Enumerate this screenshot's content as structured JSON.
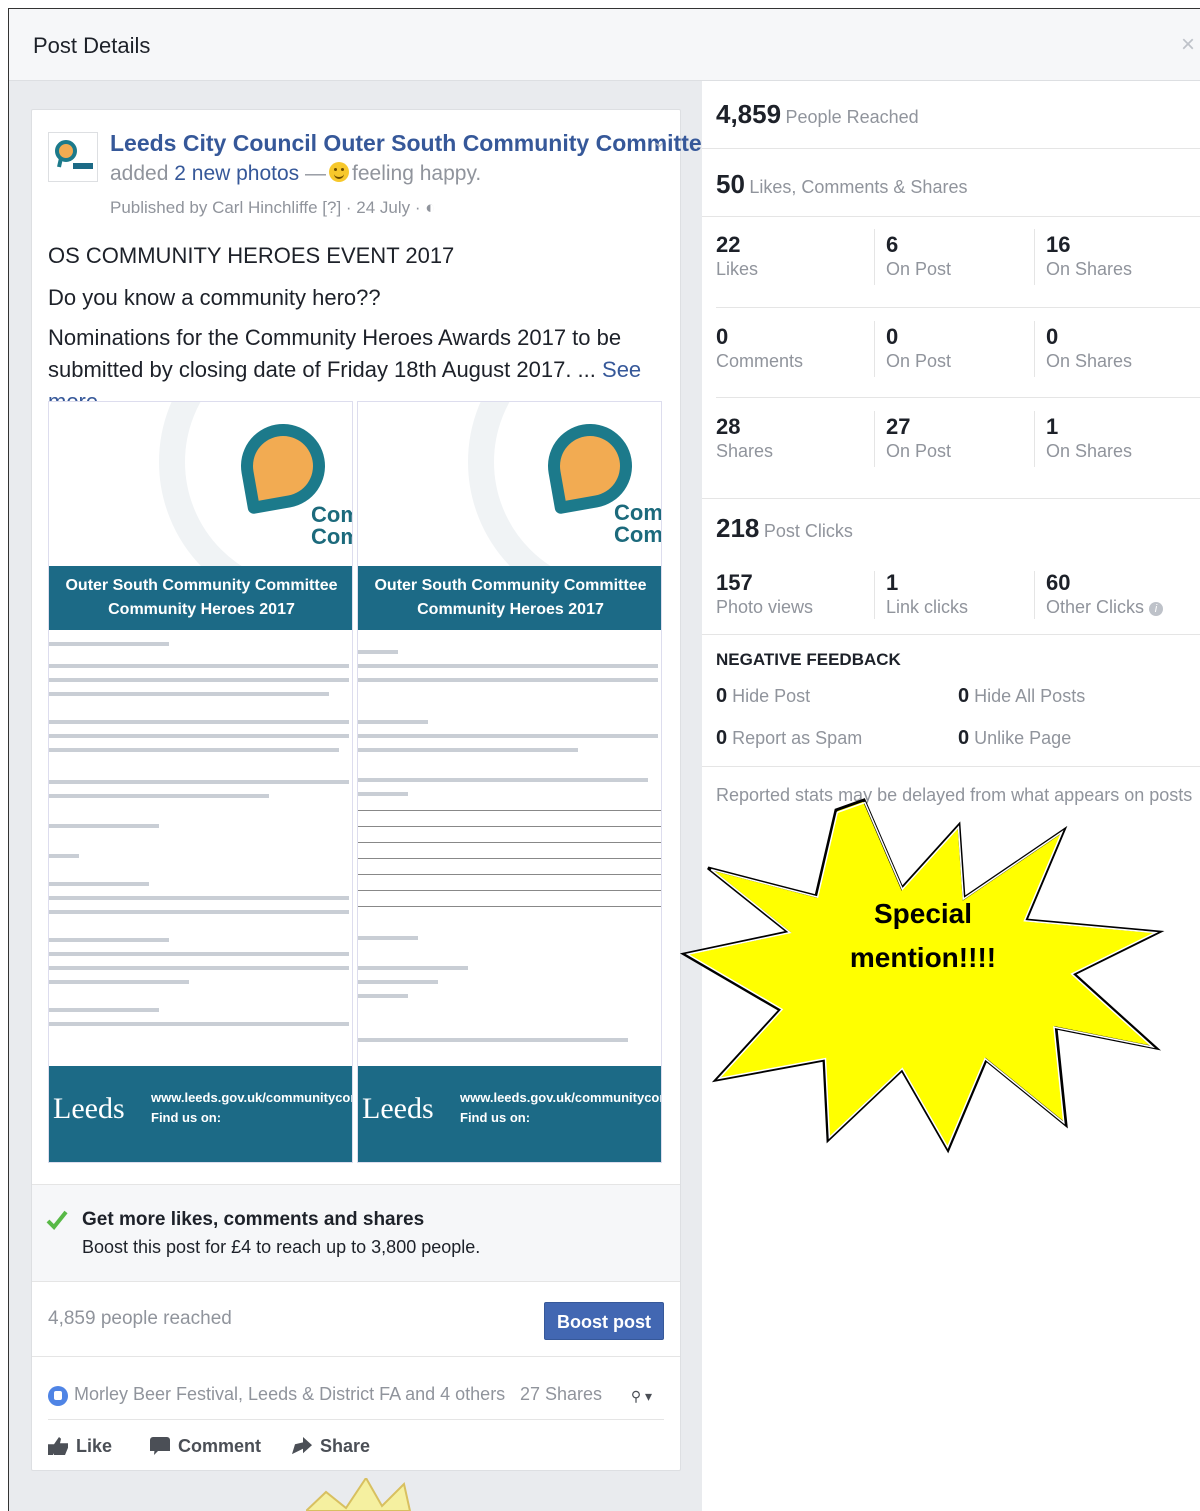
{
  "modal": {
    "title": "Post Details",
    "close_label": "×"
  },
  "post": {
    "page_name": "Leeds City Council Outer South Community Committee",
    "added_prefix": "added",
    "added_link": "2 new photos",
    "added_dash": "—",
    "feeling": "feeling happy.",
    "published": "Published by Carl Hinchliffe [?] · 24 July · ◐",
    "lines": [
      "OS COMMUNITY HEROES EVENT 2017",
      "Do you know a community hero??",
      "Nominations for the Community Heroes Awards 2017 to be submitted by closing date of Friday 18th August 2017. ..."
    ],
    "see_more": "See more",
    "posters": [
      {
        "logo_text": "Comm\nComm",
        "band_line1": "Outer South Community Committee",
        "band_line2": "Community Heroes 2017",
        "leeds": "Leeds",
        "url": "www.leeds.gov.uk/communitycom",
        "find": "Find us on:"
      },
      {
        "logo_text": "Comm\nCommi",
        "band_line1": "Outer South Community Committee",
        "band_line2": "Community Heroes 2017",
        "leeds": "Leeds",
        "url": "www.leeds.gov.uk/communitycomm",
        "find": "Find us on:"
      }
    ],
    "boost_tip_title": "Get more likes, comments and shares",
    "boost_tip_sub": "Boost this post for £4 to reach up to 3,800 people.",
    "reached_text": "4,859 people reached",
    "boost_button": "Boost post",
    "likers": "Morley Beer Festival, Leeds & District FA and 4 others",
    "shares": "27 Shares",
    "actions": {
      "like": "Like",
      "comment": "Comment",
      "share": "Share"
    }
  },
  "stats": {
    "reached": {
      "num": "4,859",
      "label": "People Reached"
    },
    "engagement": {
      "num": "50",
      "label": "Likes, Comments & Shares"
    },
    "grid": [
      [
        {
          "num": "22",
          "label": "Likes"
        },
        {
          "num": "6",
          "label": "On Post"
        },
        {
          "num": "16",
          "label": "On Shares"
        }
      ],
      [
        {
          "num": "0",
          "label": "Comments"
        },
        {
          "num": "0",
          "label": "On Post"
        },
        {
          "num": "0",
          "label": "On Shares"
        }
      ],
      [
        {
          "num": "28",
          "label": "Shares"
        },
        {
          "num": "27",
          "label": "On Post"
        },
        {
          "num": "1",
          "label": "On Shares"
        }
      ]
    ],
    "clicks": {
      "num": "218",
      "label": "Post Clicks"
    },
    "clicks_grid": [
      {
        "num": "157",
        "label": "Photo views"
      },
      {
        "num": "1",
        "label": "Link clicks"
      },
      {
        "num": "60",
        "label": "Other Clicks"
      }
    ],
    "negative": {
      "title": "NEGATIVE FEEDBACK",
      "items": [
        {
          "num": "0",
          "label": "Hide Post"
        },
        {
          "num": "0",
          "label": "Hide All Posts"
        },
        {
          "num": "0",
          "label": "Report as Spam"
        },
        {
          "num": "0",
          "label": "Unlike Page"
        }
      ]
    },
    "note": "Reported stats may be delayed from what appears on posts"
  },
  "annotation": {
    "line1": "Special",
    "line2": "mention!!!!",
    "fill": "#ffff00"
  }
}
